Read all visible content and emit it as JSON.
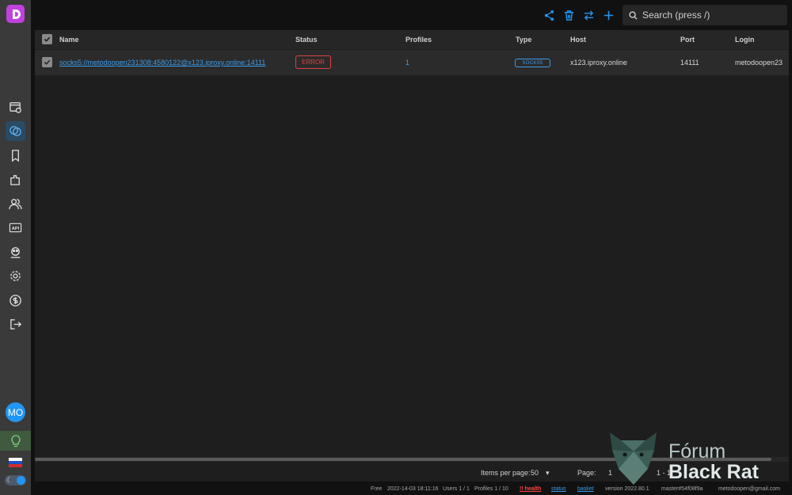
{
  "sidebar": {
    "items": [
      {
        "icon": "browser-profiles-icon",
        "active": false
      },
      {
        "icon": "proxies-icon",
        "active": true
      },
      {
        "icon": "bookmark-icon",
        "active": false
      },
      {
        "icon": "extensions-icon",
        "active": false
      },
      {
        "icon": "users-icon",
        "active": false
      },
      {
        "icon": "api-icon",
        "active": false
      },
      {
        "icon": "automation-icon",
        "active": false
      },
      {
        "icon": "settings-icon",
        "active": false
      },
      {
        "icon": "billing-icon",
        "active": false
      },
      {
        "icon": "logout-icon",
        "active": false
      }
    ],
    "api_label": "API",
    "avatar_initials": "MO"
  },
  "search": {
    "placeholder": "Search (press /)"
  },
  "table": {
    "columns": [
      "Name",
      "Status",
      "Profiles",
      "Type",
      "Host",
      "Port",
      "Login"
    ],
    "rows": [
      {
        "name": "socks5://metodoopen231308:4580122@x123.iproxy.online:14111",
        "status": "ERROR",
        "profiles": "1",
        "type": "SOCKS5",
        "host": "x123.iproxy.online",
        "port": "14111",
        "login": "metodoopen23"
      }
    ]
  },
  "pager": {
    "items_per_page_label": "Items per page:",
    "items_per_page": "50",
    "page_label": "Page:",
    "page": "1",
    "range": "1 - 1"
  },
  "statusbar": {
    "plan": "Free",
    "datetime": "2022-14-03 18:11:16",
    "users": "Users 1 / 1",
    "profiles": "Profiles 1 / 10",
    "health": "!! health",
    "status": "status",
    "basket": "basket",
    "version": "version 2022.80.1",
    "branch": "master#54f08f9a",
    "email": "metodoopen@gmail.com"
  },
  "watermark": {
    "line1": "Fórum",
    "line2": "Black Rat"
  },
  "colors": {
    "accent": "#3d9be9",
    "error": "#e04040",
    "logo": "#c040e0"
  }
}
